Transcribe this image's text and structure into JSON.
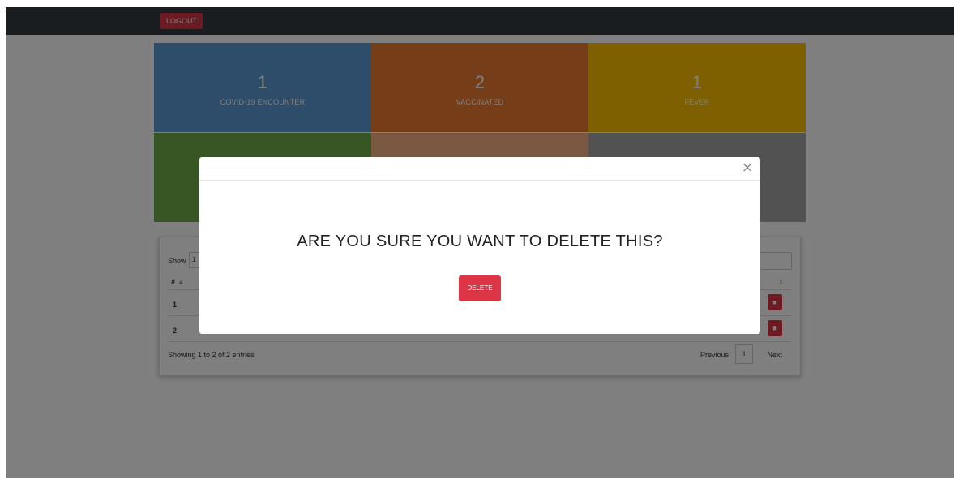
{
  "navbar": {
    "logout_label": "LOGOUT"
  },
  "tiles": [
    {
      "value": "1",
      "label": "COVID-19 ENCOUNTER"
    },
    {
      "value": "2",
      "label": "VACCINATED"
    },
    {
      "value": "1",
      "label": "FEVER"
    }
  ],
  "table": {
    "show_label": "Show",
    "length_value": "1",
    "col_hash": "#",
    "rows": [
      {
        "num": "1"
      },
      {
        "num": "2"
      }
    ],
    "entries_info": "Showing 1 to 2 of 2 entries",
    "previous_label": "Previous",
    "page": "1",
    "next_label": "Next"
  },
  "modal": {
    "message": "ARE YOU SURE YOU WANT TO DELETE THIS?",
    "delete_label": "DELETE",
    "close_symbol": "×"
  },
  "colors": {
    "danger": "#dc3545",
    "navbar": "#343a40"
  }
}
